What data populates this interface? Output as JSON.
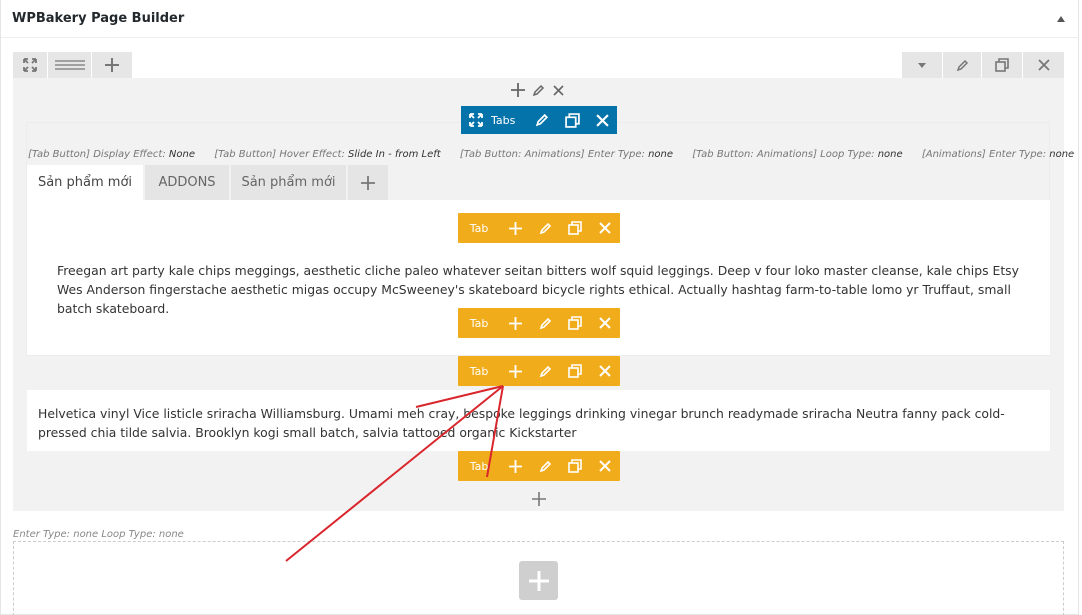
{
  "panel": {
    "title": "WPBakery Page Builder"
  },
  "toolbar": {
    "left_icons": [
      "fullscreen-icon",
      "menu-lines-icon",
      "plus-icon"
    ],
    "right_icons": [
      "chevron-down-icon",
      "pencil-icon",
      "clone-icon",
      "close-icon"
    ]
  },
  "tabs_element": {
    "label": "Tabs",
    "params": [
      {
        "key": "[Tab Button] Display Effect:",
        "value": "None"
      },
      {
        "key": "[Tab Button] Hover Effect:",
        "value": "Slide In - from Left"
      },
      {
        "key": "[Tab Button: Animations] Enter Type:",
        "value": "none"
      },
      {
        "key": "[Tab Button: Animations] Loop Type:",
        "value": "none"
      },
      {
        "key": "[Animations] Enter Type:",
        "value": "none"
      }
    ],
    "tabs": [
      "Sản phẩm mới",
      "ADDONS",
      "Sản phẩm mới"
    ],
    "active_tab": 0
  },
  "tab_control": {
    "label": "Tab"
  },
  "content": {
    "paragraph_1": "Freegan art party kale chips meggings, aesthetic cliche paleo whatever seitan bitters wolf squid leggings. Deep v four loko master cleanse, kale chips Etsy Wes Anderson fingerstache aesthetic migas occupy McSweeney's skateboard bicycle rights ethical. Actually hashtag farm-to-table lomo yr Truffaut, small batch skateboard.",
    "paragraph_2": "Helvetica vinyl Vice listicle sriracha Williamsburg. Umami meh cray, bespoke leggings drinking vinegar brunch readymade sriracha Neutra fanny pack cold-pressed chia tilde salvia. Brooklyn kogi small batch, salvia tattooed organic Kickstarter"
  },
  "row_params": "Enter Type: none  Loop Type: none",
  "colors": {
    "tabs_blue": "#0473aa",
    "tab_orange": "#f1ac1b",
    "annotation_red": "#d9262c"
  }
}
